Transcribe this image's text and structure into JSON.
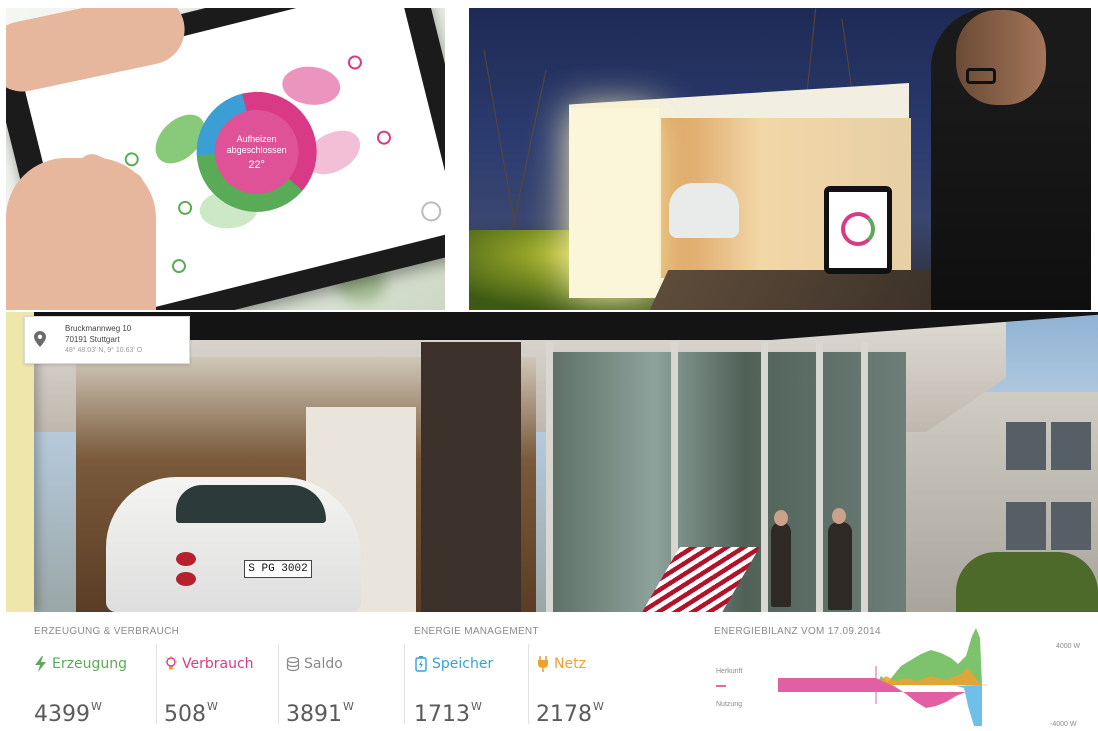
{
  "tablet_app": {
    "center_label_line1": "Aufheizen",
    "center_label_line2": "abgeschlossen",
    "center_temp": "22°"
  },
  "night_photo": {},
  "camera": {
    "location": {
      "street": "Bruckmannweg 10",
      "city": "70191 Stuttgart",
      "coordinates": "48° 48.03' N, 9° 10.63' O"
    },
    "car_plate": "S PG 3002"
  },
  "dashboard": {
    "section_generation": "ERZEUGUNG & VERBRAUCH",
    "section_management": "ENERGIE MANAGEMENT",
    "section_balance": "ENERGIEBILANZ VOM 17.09.2014",
    "metrics": [
      {
        "label": "Erzeugung",
        "value": "4399",
        "unit": "W",
        "color": "#5aab57",
        "icon": "lightning-icon"
      },
      {
        "label": "Verbrauch",
        "value": "508",
        "unit": "W",
        "color": "#d93a86",
        "icon": "lightbulb-icon"
      },
      {
        "label": "Saldo",
        "value": "3891",
        "unit": "W",
        "color": "#8a8a8a",
        "icon": "balance-icon"
      },
      {
        "label": "Speicher",
        "value": "1713",
        "unit": "W",
        "color": "#3b9fd6",
        "icon": "battery-icon"
      },
      {
        "label": "Netz",
        "value": "2178",
        "unit": "W",
        "color": "#f0a030",
        "icon": "plug-icon"
      }
    ],
    "balance_chart": {
      "legend_origin": "Herkunft",
      "legend_usage": "Nutzung",
      "axis_top": "4000 W",
      "axis_bottom": "-4000 W",
      "colors": {
        "generation": "#5aab57",
        "consumption": "#d93a86",
        "storage": "#6fc0e8",
        "grid": "#f0a030"
      }
    }
  }
}
